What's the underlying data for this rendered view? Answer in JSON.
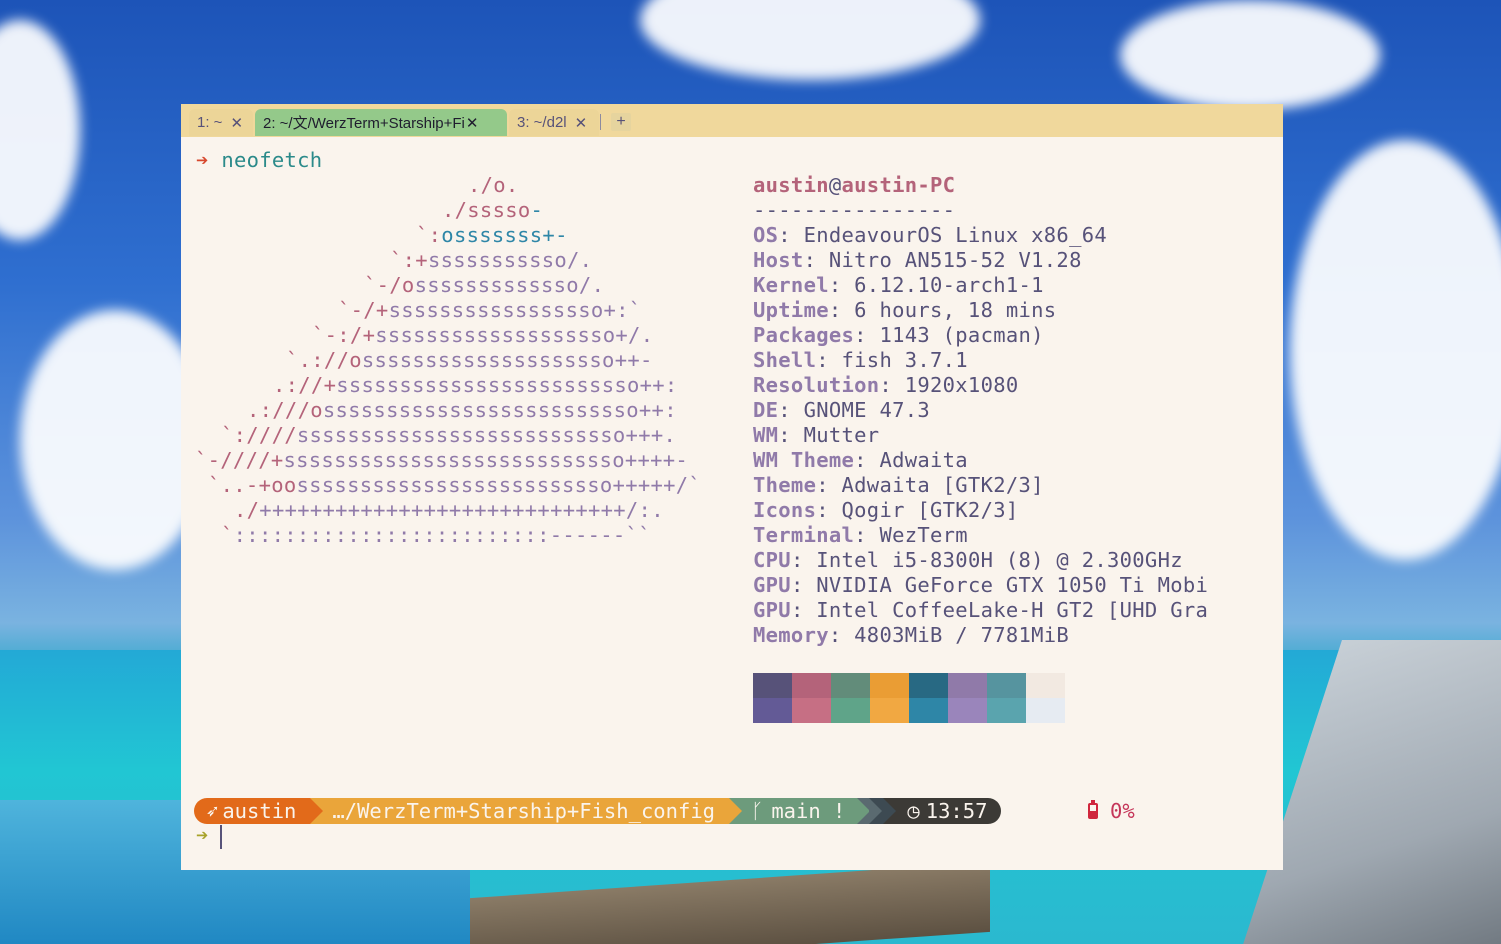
{
  "tabs": [
    {
      "label": "1: ~",
      "close": "✕"
    },
    {
      "label": "2: ~/文/WerzTerm+Starship+Fi",
      "close": "✕"
    },
    {
      "label": "3: ~/d2l",
      "close": "✕"
    }
  ],
  "new_tab_label": "+",
  "command_prompt_arrow": "➔",
  "command": "neofetch",
  "logo_lines": [
    {
      "a": "./o.",
      "b": ""
    },
    {
      "a": "./sssso",
      "b": "-"
    },
    {
      "a": "`:",
      "b": "osssssss+-"
    },
    {
      "a": "`:+",
      "b": "sssssssssso/."
    },
    {
      "a": "`-/o",
      "b": "sssssssssssso/."
    },
    {
      "a": "`-/+",
      "b": "sssssssssssssssso+:`"
    },
    {
      "a": "`-:/+",
      "b": "sssssssssssssssssso+/."
    },
    {
      "a": "`.://o",
      "b": "ssssssssssssssssssso++-"
    },
    {
      "a": ".://+",
      "b": "ssssssssssssssssssssssso++:"
    },
    {
      "a": ".:///o",
      "b": "sssssssssssssssssssssssso++:"
    },
    {
      "a": "`:////",
      "b": "ssssssssssssssssssssssssso+++."
    },
    {
      "a": "`-////+",
      "b": "sssssssssssssssssssssssssso++++-"
    },
    {
      "a": "`..-+oo",
      "b": "sssssssssssssssssssssssso+++++/`"
    },
    {
      "a": "./",
      "b": "+++++++++++++++++++++++++++++/:."
    },
    {
      "a": "`",
      "b": ":::::::::::::::::::::::::------``"
    }
  ],
  "user": "austin",
  "at": "@",
  "host": "austin-PC",
  "separator": "----------------",
  "info": [
    {
      "key": "OS",
      "value": "EndeavourOS Linux x86_64"
    },
    {
      "key": "Host",
      "value": "Nitro AN515-52 V1.28"
    },
    {
      "key": "Kernel",
      "value": "6.12.10-arch1-1"
    },
    {
      "key": "Uptime",
      "value": "6 hours, 18 mins"
    },
    {
      "key": "Packages",
      "value": "1143 (pacman)"
    },
    {
      "key": "Shell",
      "value": "fish 3.7.1"
    },
    {
      "key": "Resolution",
      "value": "1920x1080"
    },
    {
      "key": "DE",
      "value": "GNOME 47.3"
    },
    {
      "key": "WM",
      "value": "Mutter"
    },
    {
      "key": "WM Theme",
      "value": "Adwaita"
    },
    {
      "key": "Theme",
      "value": "Adwaita [GTK2/3]"
    },
    {
      "key": "Icons",
      "value": "Qogir [GTK2/3]"
    },
    {
      "key": "Terminal",
      "value": "WezTerm"
    },
    {
      "key": "CPU",
      "value": "Intel i5-8300H (8) @ 2.300GHz"
    },
    {
      "key": "GPU",
      "value": "NVIDIA GeForce GTX 1050 Ti Mobi"
    },
    {
      "key": "GPU",
      "value": "Intel CoffeeLake-H GT2 [UHD Gra"
    },
    {
      "key": "Memory",
      "value": "4803MiB / 7781MiB"
    }
  ],
  "palette_top": [
    "#575279",
    "#b4637a",
    "#628c7a",
    "#ea9d34",
    "#286983",
    "#907aa9",
    "#56949f",
    "#f2e9e1"
  ],
  "palette_bottom": [
    "#635a96",
    "#c66f84",
    "#5fa489",
    "#f1a842",
    "#2e86a7",
    "#9a85bb",
    "#5aa4ae",
    "#e6ebf2"
  ],
  "prompt": {
    "user": "austin",
    "dir": "…/WerzTerm+Starship+Fish_config",
    "git": "main !",
    "time": "13:57",
    "battery": "0%",
    "next_arrow": "➔"
  }
}
